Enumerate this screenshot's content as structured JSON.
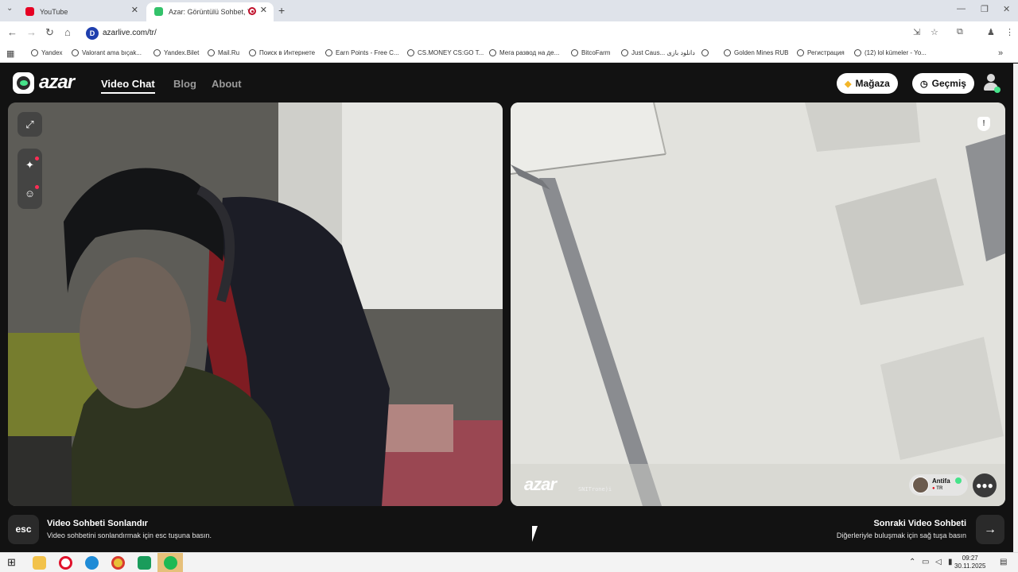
{
  "browser": {
    "tabs": [
      {
        "title": "YouTube",
        "favicon_color": "#e60023"
      },
      {
        "title": "Azar: Görüntülü Sohbet, Ye",
        "favicon_color": "#33c26a",
        "recording": true
      }
    ],
    "new_tab": "+",
    "url": "azarlive.com/tr/",
    "url_badge": "D",
    "bookmarks": [
      "Yandex",
      "Valorant ama bıçak...",
      "Yandex.Bilet",
      "Mail.Ru",
      "Поиск в Интернете",
      "Earn Points - Free C...",
      "CS.MONEY CS:GO T...",
      "Мега развод на де...",
      "BitcoFarm",
      "Just Caus... دانلود بازی",
      "",
      "Golden Mines RUB",
      "Регистрация",
      "(12) lol kümeler - Yo..."
    ]
  },
  "azar": {
    "logo_text": "azar",
    "nav": {
      "video_chat": "Video Chat",
      "blog": "Blog",
      "about": "About"
    },
    "store_label": "Mağaza",
    "history_label": "Geçmiş",
    "watermark": "azar",
    "watermark_sub": "SNITrone)i",
    "peer": {
      "name": "Antifa",
      "country": "TR"
    },
    "report_icon": "!",
    "end": {
      "key": "esc",
      "title": "Video Sohbeti Sonlandır",
      "subtitle": "Video sohbetini sonlandırmak için esc tuşuna basın."
    },
    "next": {
      "title": "Sonraki Video Sohbeti",
      "subtitle": "Diğerleriyle buluşmak için sağ tuşa basın"
    }
  },
  "taskbar": {
    "time": "09:27",
    "date": "30.11.2025",
    "apps": [
      "start",
      "file-explorer",
      "opera",
      "edge",
      "chrome",
      "android-app",
      "spotify"
    ]
  },
  "colors": {
    "accent_green": "#46e38a",
    "app_bg": "#121212",
    "record_red": "#c0102b"
  }
}
